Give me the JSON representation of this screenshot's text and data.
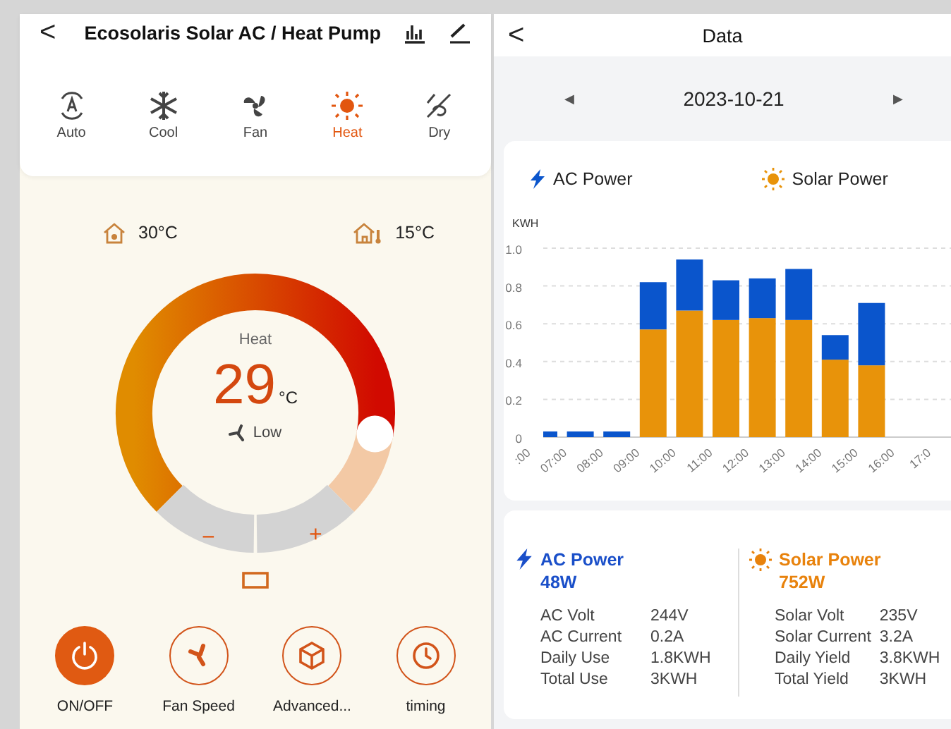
{
  "left_screen": {
    "back": "<",
    "title": "Ecosolaris Solar AC / Heat Pump",
    "modes": [
      {
        "label": "Auto",
        "kind": "auto",
        "selected": false
      },
      {
        "label": "Cool",
        "kind": "cool",
        "selected": false
      },
      {
        "label": "Fan",
        "kind": "fan",
        "selected": false
      },
      {
        "label": "Heat",
        "kind": "heat",
        "selected": true
      },
      {
        "label": "Dry",
        "kind": "dry",
        "selected": false
      }
    ],
    "indoor_temp": "30°C",
    "outdoor_temp": "15°C",
    "dial": {
      "mode": "Heat",
      "temperature": "29",
      "unit": "°C",
      "fan": "Low",
      "level": 0.87,
      "minus": "−",
      "plus": "+"
    },
    "actions": [
      {
        "label": "ON/OFF",
        "kind": "power",
        "on": true
      },
      {
        "label": "Fan Speed",
        "kind": "fan",
        "on": false
      },
      {
        "label": "Advanced...",
        "kind": "cube",
        "on": false
      },
      {
        "label": "timing",
        "kind": "clock",
        "on": false
      }
    ]
  },
  "right_screen": {
    "back": "<",
    "title": "Data",
    "prev": "◀",
    "date": "2023-10-21",
    "next": "▶",
    "chart_data": {
      "type": "bar",
      "stacked": true,
      "ylabel": "KWH",
      "categories": [
        ":00",
        "07:00",
        "08:00",
        "09:00",
        "10:00",
        "11:00",
        "12:00",
        "13:00",
        "14:00",
        "15:00",
        "16:00",
        "17:0"
      ],
      "yticks": [
        0,
        0.2,
        0.4,
        0.6,
        0.8,
        {
          "value": 1.0,
          "label": "1.0"
        }
      ],
      "ylim": [
        0,
        1.0
      ],
      "grid": true,
      "series": [
        {
          "name": "Solar Power",
          "color": "#e8930a",
          "values": [
            0,
            0,
            0,
            0.57,
            0.67,
            0.62,
            0.63,
            0.62,
            0.41,
            0.38,
            null,
            null
          ]
        },
        {
          "name": "AC Power",
          "color": "#0a55cc",
          "values": [
            0.03,
            0.03,
            0.03,
            0.25,
            0.27,
            0.21,
            0.21,
            0.27,
            0.13,
            0.33,
            null,
            null
          ]
        }
      ]
    },
    "stats": [
      {
        "kind": "ac",
        "title": "AC Power",
        "value": "48W",
        "rows": [
          {
            "label": "AC Volt",
            "value": "244V"
          },
          {
            "label": "AC Current",
            "value": "0.2A"
          },
          {
            "label": "Daily Use",
            "value": "1.8KWH"
          },
          {
            "label": "Total Use",
            "value": "3KWH"
          }
        ]
      },
      {
        "kind": "solar",
        "title": "Solar Power",
        "value": "752W",
        "rows": [
          {
            "label": "Solar Volt",
            "value": "235V"
          },
          {
            "label": "Solar Current",
            "value": "3.2A"
          },
          {
            "label": "Daily Yield",
            "value": "3.8KWH"
          },
          {
            "label": "Total Yield",
            "value": "3KWH"
          }
        ]
      }
    ]
  }
}
